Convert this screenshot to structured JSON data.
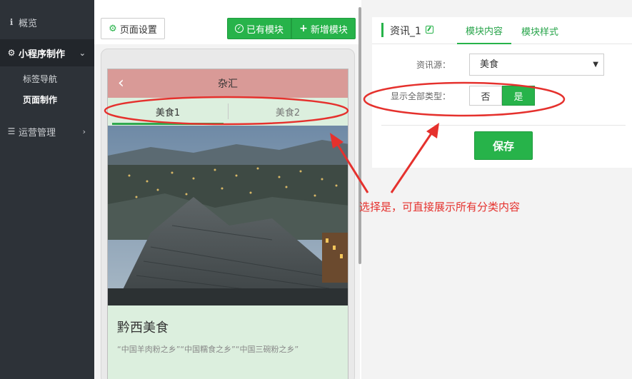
{
  "sidebar": {
    "overview": "概览",
    "miniprogram_group": "小程序制作",
    "tag_nav": "标签导航",
    "page_design": "页面制作",
    "operations": "运营管理"
  },
  "toolbar": {
    "page_settings": "页面设置",
    "existing_modules": "已有模块",
    "add_module": "新增模块"
  },
  "preview": {
    "header_title": "杂汇",
    "tabs": [
      {
        "label": "美食1"
      },
      {
        "label": "美食2"
      }
    ],
    "article_title": "黔西美食",
    "article_desc": "“中国羊肉粉之乡”“中国糯食之乡”“中国三碗粉之乡”"
  },
  "panel": {
    "module_name": "资讯_1",
    "tab_content": "模块内容",
    "tab_style": "模块样式",
    "source_label": "资讯源：",
    "source_value": "美食",
    "show_all_label": "显示全部类型：",
    "toggle_no": "否",
    "toggle_yes": "是",
    "save": "保存"
  },
  "annotation": {
    "text": "选择是，可直接展示所有分类内容",
    "color": "#e5312d"
  },
  "colors": {
    "accent": "#27b34a",
    "sidebar_bg": "#2d3238",
    "header_bg": "#d99a97"
  }
}
